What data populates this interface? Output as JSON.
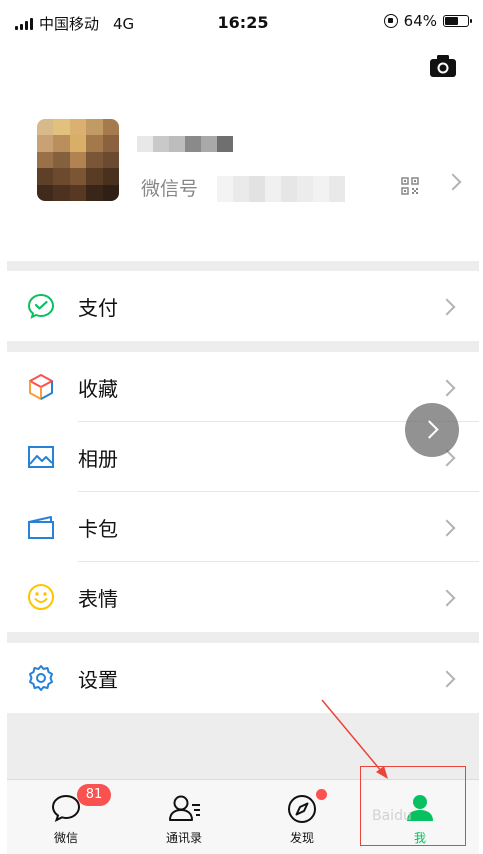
{
  "status_bar": {
    "carrier": "中国移动",
    "network": "4G",
    "time": "16:25",
    "battery": "64%",
    "battery_level": 0.64
  },
  "profile": {
    "wechat_id_label": "微信号",
    "icons": {
      "camera": "camera-icon",
      "qr": "qr-code-icon",
      "arrow": "chevron-right-icon"
    }
  },
  "menu": {
    "group1": [
      {
        "label": "支付",
        "icon": "payment-icon",
        "color": "#07c160"
      }
    ],
    "group2": [
      {
        "label": "收藏",
        "icon": "favorites-icon",
        "color": "#fa9d3b"
      },
      {
        "label": "相册",
        "icon": "album-icon",
        "color": "#2782d7"
      },
      {
        "label": "卡包",
        "icon": "card-wallet-icon",
        "color": "#2782d7"
      },
      {
        "label": "表情",
        "icon": "sticker-icon",
        "color": "#ffc300"
      }
    ],
    "group3": [
      {
        "label": "设置",
        "icon": "settings-icon",
        "color": "#2782d7"
      }
    ]
  },
  "tabbar": {
    "tabs": [
      {
        "label": "微信",
        "icon": "chat-icon",
        "badge": "81"
      },
      {
        "label": "通讯录",
        "icon": "contacts-icon"
      },
      {
        "label": "发现",
        "icon": "discover-icon",
        "dot": true
      },
      {
        "label": "我",
        "icon": "me-icon",
        "active": true
      }
    ],
    "active_color": "#07c160"
  },
  "watermark": "Baidu"
}
